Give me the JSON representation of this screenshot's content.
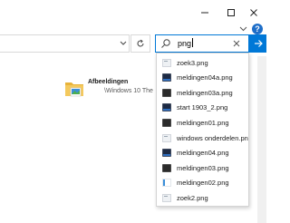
{
  "titlebar": {
    "minimize_icon": "minimize-icon",
    "maximize_icon": "maximize-icon",
    "close_icon": "close-icon"
  },
  "search": {
    "query": "png"
  },
  "content": {
    "folder_title": "Afbeeldingen",
    "folder_subtitle": "\\Windows 10 The"
  },
  "suggestions": [
    {
      "label": "zoek3.png",
      "icon": "light"
    },
    {
      "label": "meldingen04a.png",
      "icon": "dark-blue"
    },
    {
      "label": "meldingen03a.png",
      "icon": "dark"
    },
    {
      "label": "start 1903_2.png",
      "icon": "dark-blue"
    },
    {
      "label": "meldingen01.png",
      "icon": "dark"
    },
    {
      "label": "windows onderdelen.png",
      "icon": "light"
    },
    {
      "label": "meldingen04.png",
      "icon": "dark-blue"
    },
    {
      "label": "meldingen03.png",
      "icon": "dark"
    },
    {
      "label": "meldingen02.png",
      "icon": "blue-strip"
    },
    {
      "label": "zoek2.png",
      "icon": "light"
    }
  ],
  "colors": {
    "accent": "#0078d7",
    "help": "#1e6ec8",
    "folder": "#e8b33a"
  }
}
